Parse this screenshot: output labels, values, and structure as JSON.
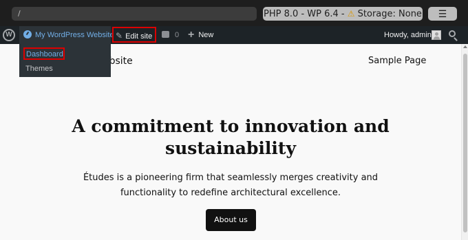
{
  "playground": {
    "url": "/",
    "env_label": "PHP 8.0 - WP 6.4 -",
    "warning_glyph": "⚠",
    "storage_label": "Storage: None",
    "menu_glyph": "☰"
  },
  "admin_bar": {
    "wp_logo": "W",
    "site_name": "My WordPress Website",
    "edit_site": "Edit site",
    "edit_site_icon": "brush-icon",
    "comments_count": "0",
    "new_label": "New",
    "new_glyph": "+",
    "howdy": "Howdy, admin"
  },
  "dropdown": {
    "items": [
      {
        "label": "Dashboard",
        "highlighted": true
      },
      {
        "label": "Themes",
        "highlighted": false
      }
    ]
  },
  "page": {
    "site_title_partial": "ebsite",
    "nav": [
      "Sample Page"
    ],
    "headline": "A commitment to innovation and sustainability",
    "lede": "Études is a pioneering firm that seamlessly merges creativity and functionality to redefine architectural excellence.",
    "cta": "About us"
  },
  "colors": {
    "highlight_border": "#dd0000",
    "admin_bar_bg": "#1d2327",
    "link_blue": "#72aee6"
  }
}
